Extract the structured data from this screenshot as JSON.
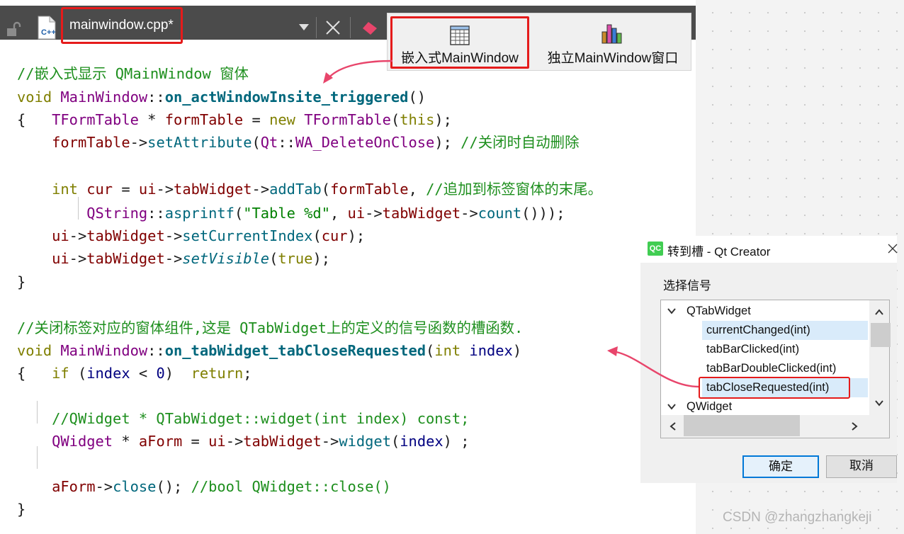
{
  "editor": {
    "file_tab": "mainwindow.cpp*",
    "file_icon_label": "C++"
  },
  "toolbar": {
    "embedded_label": "嵌入式MainWindow",
    "standalone_label": "独立MainWindow窗口"
  },
  "code_lines": [
    "//嵌入式显示 QMainWindow 窗体",
    "void MainWindow::on_actWindowInsite_triggered()",
    "{   TFormTable * formTable = new TFormTable(this);",
    "    formTable->setAttribute(Qt::WA_DeleteOnClose); //关闭时自动删除",
    "",
    "    int cur = ui->tabWidget->addTab(formTable, //追加到标签窗体的末尾。",
    "        QString::asprintf(\"Table %d\", ui->tabWidget->count()));",
    "    ui->tabWidget->setCurrentIndex(cur);",
    "    ui->tabWidget->setVisible(true);",
    "}",
    "",
    "//关闭标签对应的窗体组件,这是 QTabWidget上的定义的信号函数的槽函数.",
    "void MainWindow::on_tabWidget_tabCloseRequested(int index)",
    "{   if (index < 0)  return;",
    "",
    "    //QWidget * QTabWidget::widget(int index) const;",
    "    QWidget * aForm = ui->tabWidget->widget(index) ;",
    "",
    "    aForm->close(); //bool QWidget::close()",
    "}"
  ],
  "dialog": {
    "icon_text": "QC",
    "title": "转到槽 - Qt Creator",
    "group_label": "选择信号",
    "tree": [
      {
        "text": "QTabWidget",
        "level": 0,
        "expanded": true
      },
      {
        "text": "currentChanged(int)",
        "level": 1,
        "selected": true
      },
      {
        "text": "tabBarClicked(int)",
        "level": 1
      },
      {
        "text": "tabBarDoubleClicked(int)",
        "level": 1
      },
      {
        "text": "tabCloseRequested(int)",
        "level": 1,
        "highlighted": true
      },
      {
        "text": "QWidget",
        "level": 0,
        "expanded": true
      }
    ],
    "ok_label": "确定",
    "cancel_label": "取消"
  },
  "watermark": "CSDN @zhangzhangkeji",
  "colors": {
    "annotation_red": "#e51b1b",
    "arrow_pink": "#e8456b",
    "tab_bar": "#4b4b4b",
    "comment_green": "#1e8f1e",
    "keyword_olive": "#7f7f00",
    "type_purple": "#800080",
    "function_teal": "#00677c",
    "member_maroon": "#800000"
  }
}
